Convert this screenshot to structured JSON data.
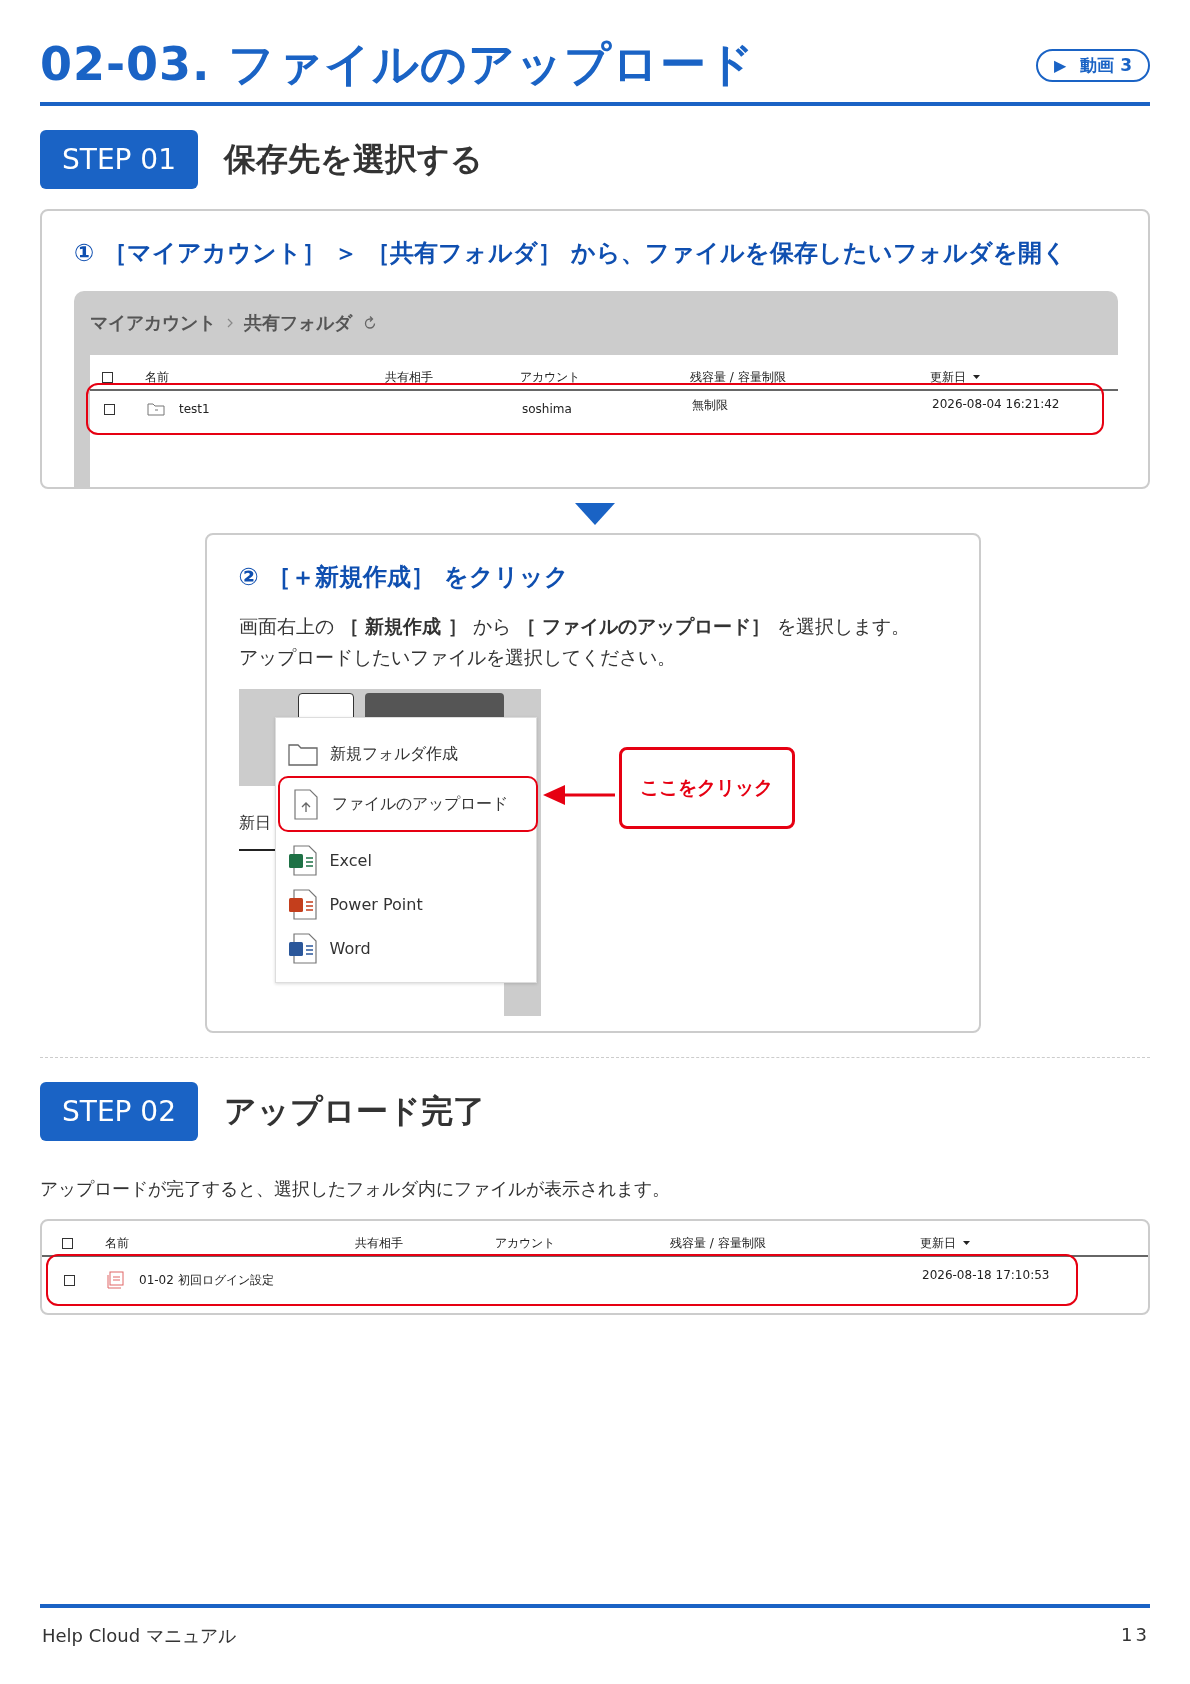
{
  "header": {
    "title": "02-03. ファイルのアップロード",
    "video_badge": {
      "icon": "▶",
      "label": "動画 3"
    }
  },
  "step1": {
    "badge": "STEP 01",
    "title": "保存先を選択する",
    "panel1": {
      "heading": "① ［マイアカウント］ ＞ ［共有フォルダ］ から、ファイルを保存したいフォルダを開く",
      "breadcrumb": [
        {
          "label": "マイアカウント"
        },
        {
          "label": "共有フォルダ"
        }
      ],
      "columns": [
        "名前",
        "共有相手",
        "アカウント",
        "残容量 / 容量制限",
        "更新日"
      ],
      "header_checked": false,
      "rows": [
        {
          "checked": false,
          "highlighted": true,
          "kind": "folder",
          "name": "test1",
          "account": "soshima",
          "quota": "無制限",
          "updated": "2026-08-04 16:21:42"
        }
      ]
    },
    "panel2": {
      "heading": "② ［＋新規作成］ をクリック",
      "body": [
        "画面右上の **［ 新規作成 ］** から **［ ファイルのアップロード］** を選択します。",
        "アップロードしたいファイルを選択してください。"
      ],
      "partial_text": "新日",
      "menu": [
        {
          "kind": "folder",
          "label": "新規フォルダ作成",
          "highlighted": false
        },
        {
          "kind": "upload",
          "label": "ファイルのアップロード",
          "highlighted": true
        },
        {
          "kind": "excel",
          "label": "Excel",
          "highlighted": false
        },
        {
          "kind": "powerpoint",
          "label": "Power Point",
          "highlighted": false
        },
        {
          "kind": "word",
          "label": "Word",
          "highlighted": false
        }
      ],
      "callout": "ここをクリック"
    }
  },
  "step2": {
    "badge": "STEP 02",
    "title": "アップロード完了",
    "text": "アップロードが完了すると、選択したフォルダ内にファイルが表示されます。",
    "columns": [
      "名前",
      "共有相手",
      "アカウント",
      "残容量 / 容量制限",
      "更新日"
    ],
    "header_checked": false,
    "rows": [
      {
        "checked": false,
        "highlighted": true,
        "kind": "pdf",
        "name": "01-02 初回ログイン設定",
        "updated": "2026-08-18 17:10:53"
      }
    ]
  },
  "footer": {
    "manual": "Help Cloud マニュアル",
    "page": "13"
  }
}
